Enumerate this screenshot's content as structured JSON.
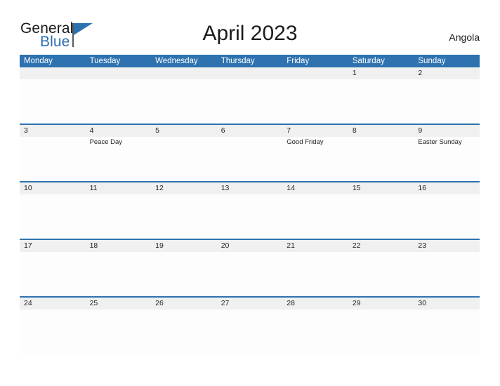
{
  "brand": {
    "name_part1": "General",
    "name_part2": "Blue",
    "triangle_icon": "triangle-logo-icon",
    "accent_color": "#2b72b2"
  },
  "header": {
    "title": "April 2023",
    "country": "Angola"
  },
  "colors": {
    "header_blue": "#2e72b0",
    "date_band_gray": "#f0f0f0",
    "text_dark": "#222222",
    "logo_blue": "#2b6cb0"
  },
  "calendar": {
    "month": "April",
    "year": "2023",
    "weekday_headers": [
      "Monday",
      "Tuesday",
      "Wednesday",
      "Thursday",
      "Friday",
      "Saturday",
      "Sunday"
    ],
    "weeks": [
      {
        "days": [
          {
            "date": "",
            "events": []
          },
          {
            "date": "",
            "events": []
          },
          {
            "date": "",
            "events": []
          },
          {
            "date": "",
            "events": []
          },
          {
            "date": "",
            "events": []
          },
          {
            "date": "1",
            "events": []
          },
          {
            "date": "2",
            "events": []
          }
        ]
      },
      {
        "days": [
          {
            "date": "3",
            "events": []
          },
          {
            "date": "4",
            "events": [
              "Peace Day"
            ]
          },
          {
            "date": "5",
            "events": []
          },
          {
            "date": "6",
            "events": []
          },
          {
            "date": "7",
            "events": [
              "Good Friday"
            ]
          },
          {
            "date": "8",
            "events": []
          },
          {
            "date": "9",
            "events": [
              "Easter Sunday"
            ]
          }
        ]
      },
      {
        "days": [
          {
            "date": "10",
            "events": []
          },
          {
            "date": "11",
            "events": []
          },
          {
            "date": "12",
            "events": []
          },
          {
            "date": "13",
            "events": []
          },
          {
            "date": "14",
            "events": []
          },
          {
            "date": "15",
            "events": []
          },
          {
            "date": "16",
            "events": []
          }
        ]
      },
      {
        "days": [
          {
            "date": "17",
            "events": []
          },
          {
            "date": "18",
            "events": []
          },
          {
            "date": "19",
            "events": []
          },
          {
            "date": "20",
            "events": []
          },
          {
            "date": "21",
            "events": []
          },
          {
            "date": "22",
            "events": []
          },
          {
            "date": "23",
            "events": []
          }
        ]
      },
      {
        "days": [
          {
            "date": "24",
            "events": []
          },
          {
            "date": "25",
            "events": []
          },
          {
            "date": "26",
            "events": []
          },
          {
            "date": "27",
            "events": []
          },
          {
            "date": "28",
            "events": []
          },
          {
            "date": "29",
            "events": []
          },
          {
            "date": "30",
            "events": []
          }
        ]
      }
    ]
  }
}
